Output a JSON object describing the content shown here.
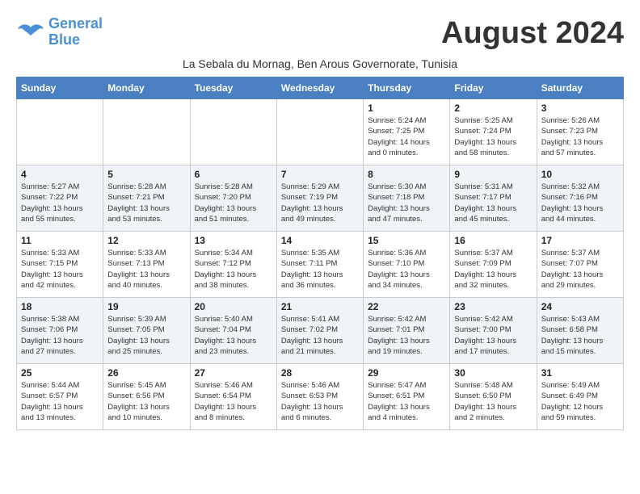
{
  "logo": {
    "line1": "General",
    "line2": "Blue"
  },
  "month_title": "August 2024",
  "subtitle": "La Sebala du Mornag, Ben Arous Governorate, Tunisia",
  "days_of_week": [
    "Sunday",
    "Monday",
    "Tuesday",
    "Wednesday",
    "Thursday",
    "Friday",
    "Saturday"
  ],
  "weeks": [
    [
      {
        "day": "",
        "info": ""
      },
      {
        "day": "",
        "info": ""
      },
      {
        "day": "",
        "info": ""
      },
      {
        "day": "",
        "info": ""
      },
      {
        "day": "1",
        "info": "Sunrise: 5:24 AM\nSunset: 7:25 PM\nDaylight: 14 hours\nand 0 minutes."
      },
      {
        "day": "2",
        "info": "Sunrise: 5:25 AM\nSunset: 7:24 PM\nDaylight: 13 hours\nand 58 minutes."
      },
      {
        "day": "3",
        "info": "Sunrise: 5:26 AM\nSunset: 7:23 PM\nDaylight: 13 hours\nand 57 minutes."
      }
    ],
    [
      {
        "day": "4",
        "info": "Sunrise: 5:27 AM\nSunset: 7:22 PM\nDaylight: 13 hours\nand 55 minutes."
      },
      {
        "day": "5",
        "info": "Sunrise: 5:28 AM\nSunset: 7:21 PM\nDaylight: 13 hours\nand 53 minutes."
      },
      {
        "day": "6",
        "info": "Sunrise: 5:28 AM\nSunset: 7:20 PM\nDaylight: 13 hours\nand 51 minutes."
      },
      {
        "day": "7",
        "info": "Sunrise: 5:29 AM\nSunset: 7:19 PM\nDaylight: 13 hours\nand 49 minutes."
      },
      {
        "day": "8",
        "info": "Sunrise: 5:30 AM\nSunset: 7:18 PM\nDaylight: 13 hours\nand 47 minutes."
      },
      {
        "day": "9",
        "info": "Sunrise: 5:31 AM\nSunset: 7:17 PM\nDaylight: 13 hours\nand 45 minutes."
      },
      {
        "day": "10",
        "info": "Sunrise: 5:32 AM\nSunset: 7:16 PM\nDaylight: 13 hours\nand 44 minutes."
      }
    ],
    [
      {
        "day": "11",
        "info": "Sunrise: 5:33 AM\nSunset: 7:15 PM\nDaylight: 13 hours\nand 42 minutes."
      },
      {
        "day": "12",
        "info": "Sunrise: 5:33 AM\nSunset: 7:13 PM\nDaylight: 13 hours\nand 40 minutes."
      },
      {
        "day": "13",
        "info": "Sunrise: 5:34 AM\nSunset: 7:12 PM\nDaylight: 13 hours\nand 38 minutes."
      },
      {
        "day": "14",
        "info": "Sunrise: 5:35 AM\nSunset: 7:11 PM\nDaylight: 13 hours\nand 36 minutes."
      },
      {
        "day": "15",
        "info": "Sunrise: 5:36 AM\nSunset: 7:10 PM\nDaylight: 13 hours\nand 34 minutes."
      },
      {
        "day": "16",
        "info": "Sunrise: 5:37 AM\nSunset: 7:09 PM\nDaylight: 13 hours\nand 32 minutes."
      },
      {
        "day": "17",
        "info": "Sunrise: 5:37 AM\nSunset: 7:07 PM\nDaylight: 13 hours\nand 29 minutes."
      }
    ],
    [
      {
        "day": "18",
        "info": "Sunrise: 5:38 AM\nSunset: 7:06 PM\nDaylight: 13 hours\nand 27 minutes."
      },
      {
        "day": "19",
        "info": "Sunrise: 5:39 AM\nSunset: 7:05 PM\nDaylight: 13 hours\nand 25 minutes."
      },
      {
        "day": "20",
        "info": "Sunrise: 5:40 AM\nSunset: 7:04 PM\nDaylight: 13 hours\nand 23 minutes."
      },
      {
        "day": "21",
        "info": "Sunrise: 5:41 AM\nSunset: 7:02 PM\nDaylight: 13 hours\nand 21 minutes."
      },
      {
        "day": "22",
        "info": "Sunrise: 5:42 AM\nSunset: 7:01 PM\nDaylight: 13 hours\nand 19 minutes."
      },
      {
        "day": "23",
        "info": "Sunrise: 5:42 AM\nSunset: 7:00 PM\nDaylight: 13 hours\nand 17 minutes."
      },
      {
        "day": "24",
        "info": "Sunrise: 5:43 AM\nSunset: 6:58 PM\nDaylight: 13 hours\nand 15 minutes."
      }
    ],
    [
      {
        "day": "25",
        "info": "Sunrise: 5:44 AM\nSunset: 6:57 PM\nDaylight: 13 hours\nand 13 minutes."
      },
      {
        "day": "26",
        "info": "Sunrise: 5:45 AM\nSunset: 6:56 PM\nDaylight: 13 hours\nand 10 minutes."
      },
      {
        "day": "27",
        "info": "Sunrise: 5:46 AM\nSunset: 6:54 PM\nDaylight: 13 hours\nand 8 minutes."
      },
      {
        "day": "28",
        "info": "Sunrise: 5:46 AM\nSunset: 6:53 PM\nDaylight: 13 hours\nand 6 minutes."
      },
      {
        "day": "29",
        "info": "Sunrise: 5:47 AM\nSunset: 6:51 PM\nDaylight: 13 hours\nand 4 minutes."
      },
      {
        "day": "30",
        "info": "Sunrise: 5:48 AM\nSunset: 6:50 PM\nDaylight: 13 hours\nand 2 minutes."
      },
      {
        "day": "31",
        "info": "Sunrise: 5:49 AM\nSunset: 6:49 PM\nDaylight: 12 hours\nand 59 minutes."
      }
    ]
  ]
}
